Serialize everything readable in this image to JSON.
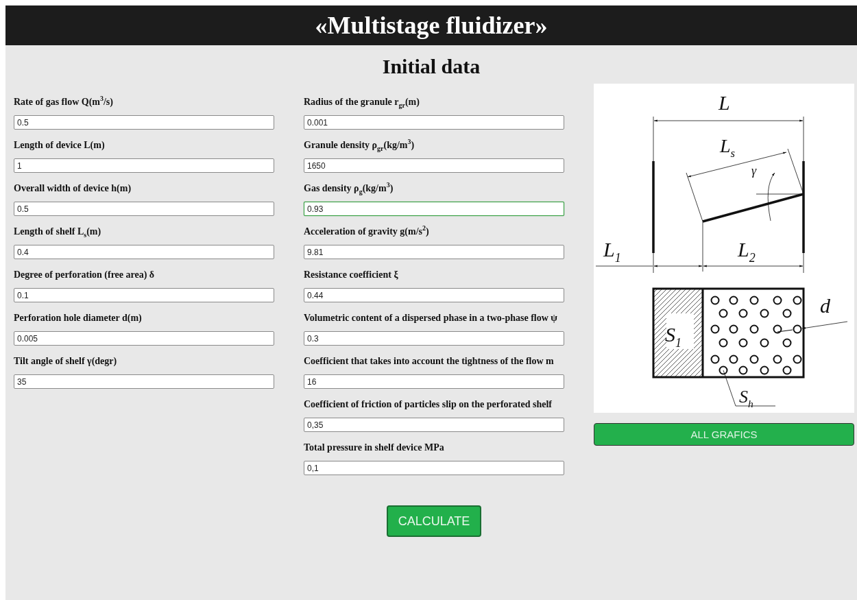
{
  "header": {
    "title": "«Multistage fluidizer»"
  },
  "heading": "Initial data",
  "left_fields": [
    {
      "label": "Rate of gas flow Q(m$^{3}$/s)",
      "value": "0.5",
      "focused": false
    },
    {
      "label": "Length of device L(m)",
      "value": "1",
      "focused": false
    },
    {
      "label": "Overall width of device h(m)",
      "value": "0.5",
      "focused": false
    },
    {
      "label": "Length of shelf L$_{s}$(m)",
      "value": "0.4",
      "focused": false
    },
    {
      "label": "Degree of perforation (free area) δ",
      "value": "0.1",
      "focused": false
    },
    {
      "label": "Perforation hole diameter d(m)",
      "value": "0.005",
      "focused": false
    },
    {
      "label": "Tilt angle of shelf γ(degr)",
      "value": "35",
      "focused": false
    }
  ],
  "middle_fields": [
    {
      "label": "Radius of the granule r$_{gr}$(m)",
      "value": "0.001",
      "focused": false
    },
    {
      "label": "Granule density ρ$_{gr}$(kg/m$^{3}$)",
      "value": "1650",
      "focused": false
    },
    {
      "label": "Gas density ρ$_{g}$(kg/m$^{3}$)",
      "value": "0.93",
      "focused": true
    },
    {
      "label": "Acceleration of gravity g(m/s$^{2}$)",
      "value": "9.81",
      "focused": false
    },
    {
      "label": "Resistance coefficient ξ",
      "value": "0.44",
      "focused": false
    },
    {
      "label": "Volumetric content of a dispersed phase in a two-phase flow ψ",
      "value": "0.3",
      "focused": false
    },
    {
      "label": "Coefficient that takes into account the tightness of the flow m",
      "value": "16",
      "focused": false
    },
    {
      "label": "Coefficient of friction of particles slip on the perforated shelf",
      "value": "0,35",
      "focused": false
    },
    {
      "label": "Total pressure in shelf device  MPa",
      "value": "0,1",
      "focused": false
    }
  ],
  "diagram": {
    "labels": [
      {
        "text": "L"
      },
      {
        "text": "L",
        "sub": "s"
      },
      {
        "text": "γ"
      },
      {
        "text": "L",
        "sub": "1"
      },
      {
        "text": "L",
        "sub": "2"
      },
      {
        "text": "S",
        "sub": "1"
      },
      {
        "text": "d"
      },
      {
        "text": "S",
        "sub": "h"
      }
    ]
  },
  "graphs_button": "ALL GRAFICS",
  "calculate_button": "CALCULATE"
}
